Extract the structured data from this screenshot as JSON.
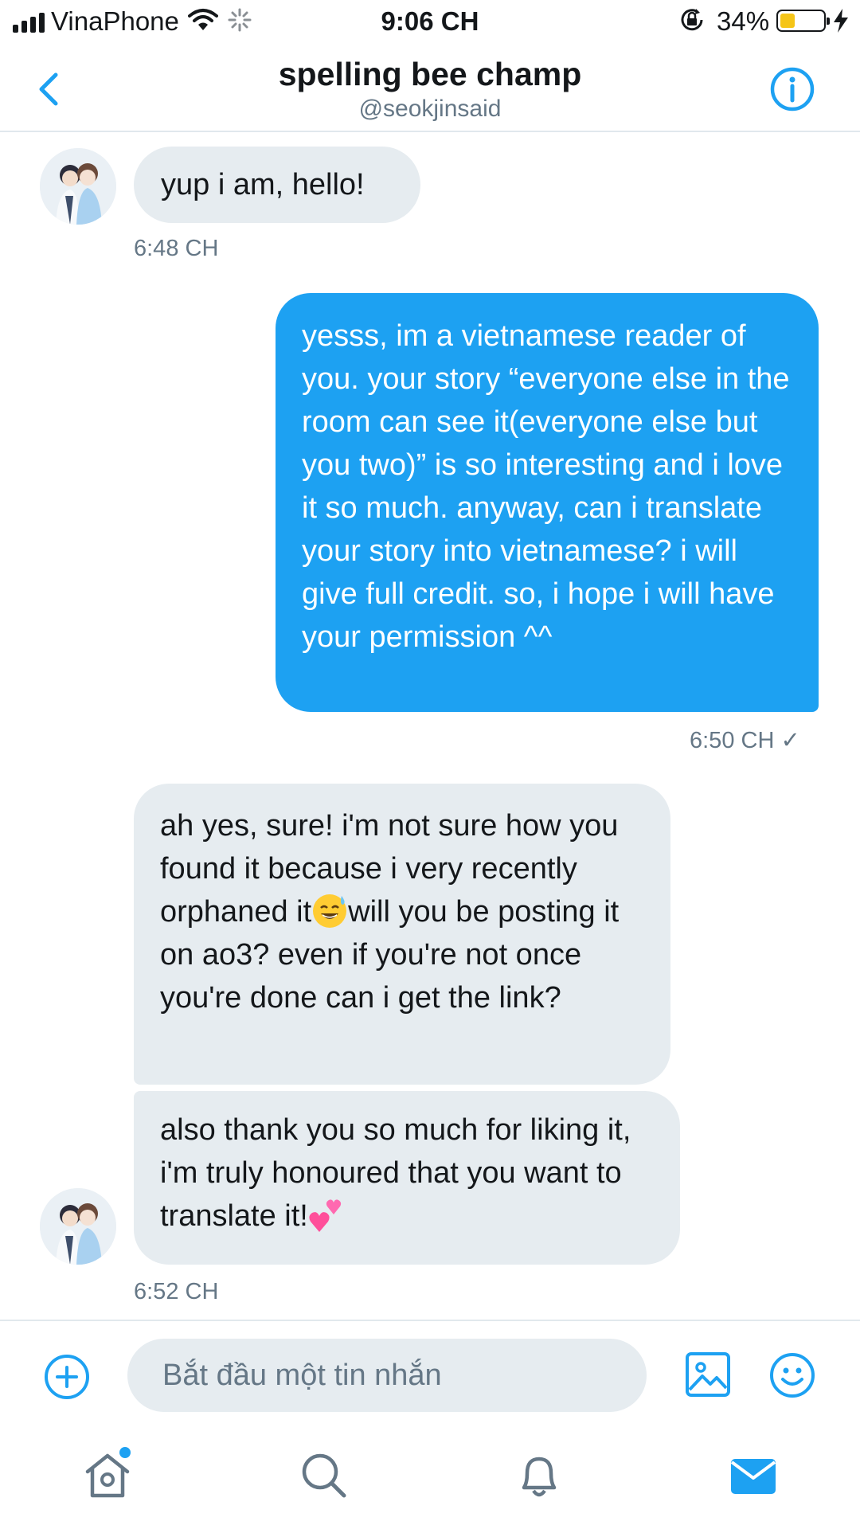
{
  "status_bar": {
    "carrier": "VinaPhone",
    "time": "9:06 CH",
    "battery_percent": "34%",
    "battery_level": 0.34,
    "battery_color": "#f5c518"
  },
  "header": {
    "title": "spelling bee champ",
    "handle": "@seokjinsaid",
    "back_icon": "chevron-left-icon",
    "info_icon": "info-icon"
  },
  "messages": [
    {
      "direction": "received",
      "text": "yup i am, hello!",
      "time": "6:48 CH"
    },
    {
      "direction": "sent",
      "text": "yesss, im a vietnamese reader of you. your story “everyone else in the room can see it(everyone else but you two)” is so interesting and i love it so much. anyway, can i translate your story into vietnamese? i will give full credit. so, i hope i will have your permission ^^",
      "time": "6:50 CH",
      "status": "✓"
    },
    {
      "direction": "received",
      "text_before": "ah yes, sure! i'm not sure how you found it because i very recently orphaned it",
      "emoji": "sweat-smile-emoji",
      "text_after": "will you be posting it on ao3? even if you're not once you're done can i get the link?"
    },
    {
      "direction": "received",
      "text": "also thank you so much for liking it, i'm truly honoured that you want to translate it!",
      "emoji": "two-hearts-emoji",
      "time": "6:52 CH"
    }
  ],
  "composer": {
    "placeholder": "Bắt đầu một tin nhắn",
    "add_icon": "plus-circle-icon",
    "image_icon": "image-icon",
    "emoji_icon": "smiley-icon"
  },
  "tabbar": {
    "items": [
      "home-icon",
      "search-icon",
      "bell-icon",
      "mail-icon"
    ],
    "active": "mail-icon"
  },
  "colors": {
    "accent": "#1da1f2",
    "received_bubble": "#e6ecf0",
    "secondary_text": "#657786"
  }
}
